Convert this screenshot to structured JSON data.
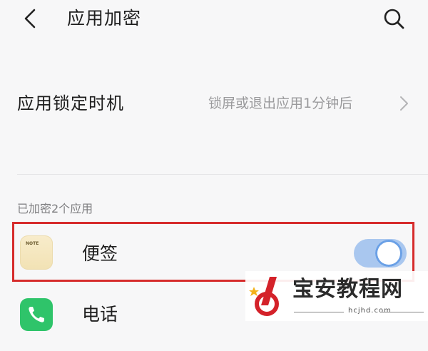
{
  "header": {
    "title": "应用加密"
  },
  "lock_timing": {
    "label": "应用锁定时机",
    "value": "锁屏或退出应用1分钟后"
  },
  "section": {
    "label": "已加密2个应用"
  },
  "apps": [
    {
      "name": "便签",
      "icon_text": "NOTE",
      "toggle_on": true
    },
    {
      "name": "电话"
    }
  ],
  "watermark": {
    "name": "宝安教程网",
    "url": "hcjhd.com"
  },
  "colors": {
    "accent": "#6aa0e6",
    "highlight": "#d62c2c",
    "phone": "#2fc46a"
  }
}
